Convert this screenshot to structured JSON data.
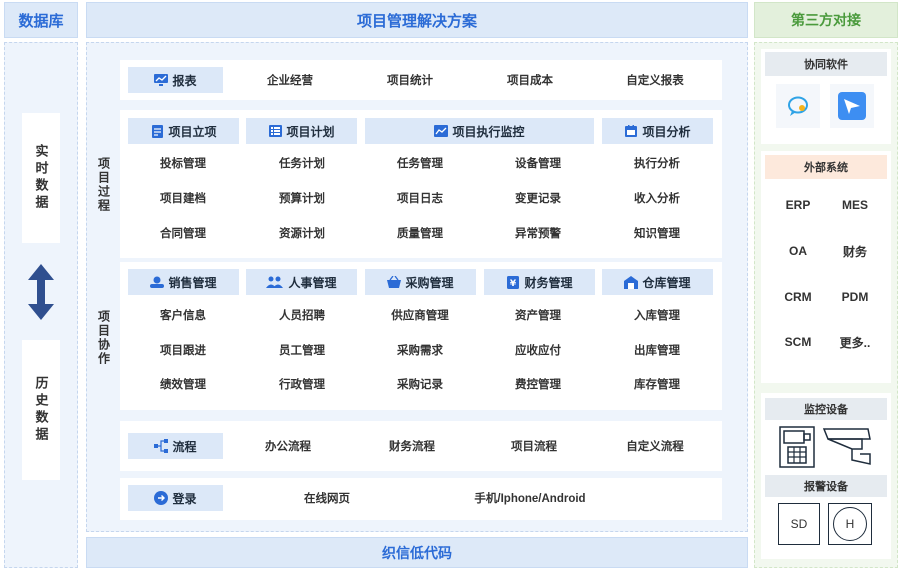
{
  "db": {
    "title": "数据库",
    "realtime": "实时数据",
    "history": "历史数据"
  },
  "main": {
    "title": "项目管理解决方案",
    "footer": "织信低代码",
    "report": {
      "label": "报表",
      "items": [
        "企业经营",
        "项目统计",
        "项目成本",
        "自定义报表"
      ]
    },
    "process": {
      "side_label": "项目过程",
      "headers": [
        "项目立项",
        "项目计划",
        "项目执行监控",
        "项目分析"
      ],
      "rows": [
        [
          "投标管理",
          "任务计划",
          "任务管理",
          "设备管理",
          "执行分析"
        ],
        [
          "项目建档",
          "预算计划",
          "项目日志",
          "变更记录",
          "收入分析"
        ],
        [
          "合同管理",
          "资源计划",
          "质量管理",
          "异常预警",
          "知识管理"
        ]
      ]
    },
    "collab": {
      "side_label": "项目协作",
      "headers": [
        "销售管理",
        "人事管理",
        "采购管理",
        "财务管理",
        "仓库管理"
      ],
      "rows": [
        [
          "客户信息",
          "人员招聘",
          "供应商管理",
          "资产管理",
          "入库管理"
        ],
        [
          "项目跟进",
          "员工管理",
          "采购需求",
          "应收应付",
          "出库管理"
        ],
        [
          "绩效管理",
          "行政管理",
          "采购记录",
          "费控管理",
          "库存管理"
        ]
      ]
    },
    "flow": {
      "label": "流程",
      "items": [
        "办公流程",
        "财务流程",
        "项目流程",
        "自定义流程"
      ]
    },
    "login": {
      "label": "登录",
      "items": [
        "在线网页",
        "手机/Iphone/Android"
      ]
    }
  },
  "third": {
    "title": "第三方对接",
    "collab_title": "协同软件",
    "external_title": "外部系统",
    "external": [
      "ERP",
      "MES",
      "OA",
      "财务",
      "CRM",
      "PDM",
      "SCM",
      "更多.."
    ],
    "monitor_title": "监控设备",
    "alarm_title": "报警设备",
    "alarm": [
      "SD",
      "H"
    ]
  },
  "colors": {
    "accent": "#2b6bd6",
    "header_bg": "#dde9f8",
    "label_bg": "#dce8f8",
    "third_header": "#e3f0dc",
    "third_text": "#4a9a3c",
    "external_hdr": "#fde9dc"
  }
}
